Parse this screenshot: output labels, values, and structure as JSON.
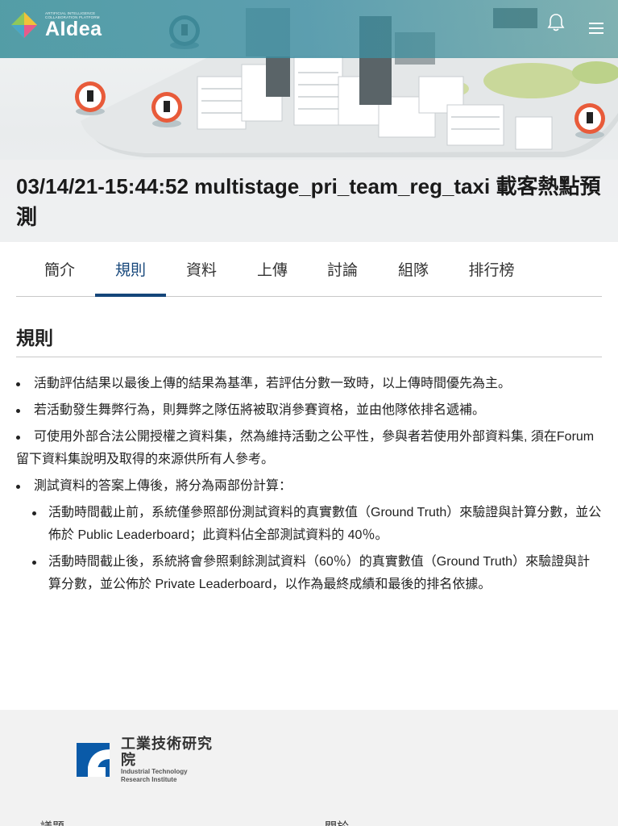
{
  "header": {
    "logo_small": "ARTIFICIAL INTELLIGENCE COLLABORATION PLATFORM",
    "logo_name": "AIdea"
  },
  "title": {
    "latin": "03/14/21-15:44:52 multistage_pri_team_reg_taxi",
    "chinese": "載客熱點預測"
  },
  "tabs": [
    {
      "label": "簡介",
      "active": false
    },
    {
      "label": "規則",
      "active": true
    },
    {
      "label": "資料",
      "active": false
    },
    {
      "label": "上傳",
      "active": false
    },
    {
      "label": "討論",
      "active": false
    },
    {
      "label": "組隊",
      "active": false
    },
    {
      "label": "排行榜",
      "active": false
    }
  ],
  "section": {
    "title": "規則",
    "rules": [
      "活動評估結果以最後上傳的結果為基準，若評估分數一致時，以上傳時間優先為主。",
      "若活動發生舞弊行為，則舞弊之隊伍將被取消參賽資格，並由他隊依排名遞補。",
      "可使用外部合法公開授權之資料集，然為維持活動之公平性，參與者若使用外部資料集, 須在Forum留下資料集說明及取得的來源供所有人參考。",
      "測試資料的答案上傳後，將分為兩部份計算："
    ],
    "sub_rules": [
      "活動時間截止前，系統僅參照部份測試資料的真實數值（Ground Truth）來驗證與計算分數，並公佈於 Public Leaderboard；此資料佔全部測試資料的 40％。",
      "活動時間截止後，系統將會參照剩餘測試資料（60％）的真實數值（Ground Truth）來驗證與計算分數，並公佈於 Private Leaderboard，以作為最終成績和最後的排名依據。"
    ]
  },
  "footer": {
    "org_cn": "工業技術研究院",
    "org_en_1": "Industrial Technology",
    "org_en_2": "Research Institute",
    "link_left": "議題",
    "link_right": "關於"
  },
  "colors": {
    "accent": "#15467a",
    "header": "#4696a0",
    "itri_blue": "#0a5aa8"
  }
}
